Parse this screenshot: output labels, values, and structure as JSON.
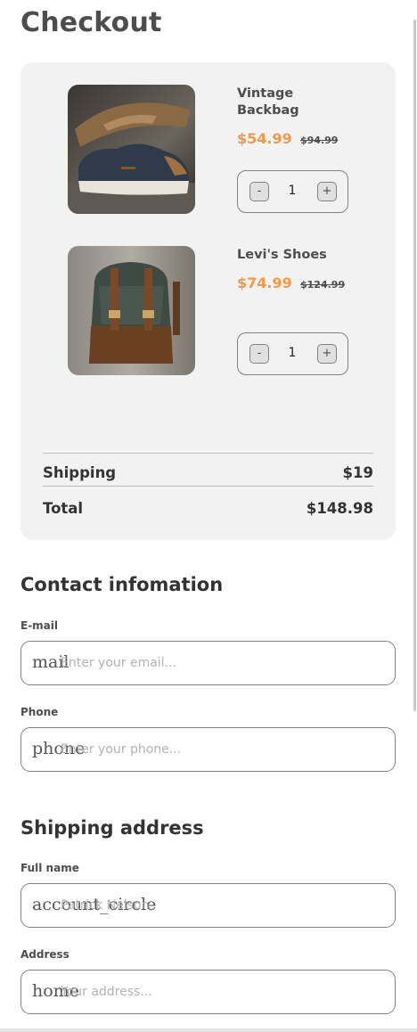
{
  "page": {
    "title": "Checkout"
  },
  "colors": {
    "accent": "#f2994a",
    "cart_bg": "#f2f2f2",
    "text": "#333333"
  },
  "cart": {
    "items": [
      {
        "name": "Vintage Backbag",
        "price": "$54.99",
        "old_price": "$94.99",
        "quantity": "1",
        "image": "sneaker-photo",
        "minus": "-",
        "plus": "+"
      },
      {
        "name": "Levi's Shoes",
        "price": "$74.99",
        "old_price": "$124.99",
        "quantity": "1",
        "image": "backpack-photo",
        "minus": "-",
        "plus": "+"
      }
    ],
    "shipping_label": "Shipping",
    "shipping_value": "$19",
    "total_label": "Total",
    "total_value": "$148.98"
  },
  "contact": {
    "heading": "Contact infomation",
    "email": {
      "label": "E-mail",
      "icon": "mail",
      "placeholder": "Enter your email..."
    },
    "phone": {
      "label": "Phone",
      "icon": "phone",
      "placeholder": "Enter your phone..."
    }
  },
  "shipping": {
    "heading": "Shipping address",
    "full_name": {
      "label": "Full name",
      "icon": "account_circle",
      "placeholder": "Patrick Nelson"
    },
    "address": {
      "label": "Address",
      "icon": "home",
      "placeholder": "Your address..."
    }
  }
}
